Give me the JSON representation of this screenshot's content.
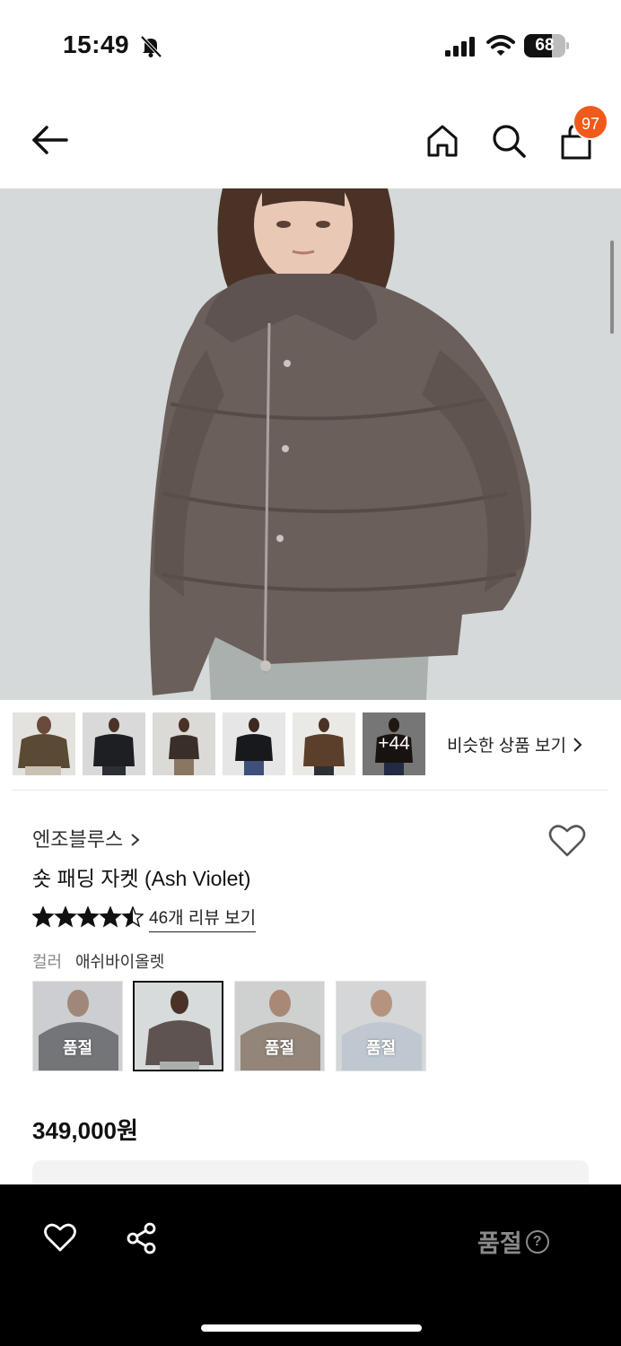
{
  "status": {
    "time": "15:49",
    "battery": "68",
    "battery_level": 0.68,
    "icons": [
      "bell-slash-icon",
      "signal-icon",
      "wifi-icon",
      "battery-icon"
    ]
  },
  "nav": {
    "icons": [
      "back-arrow-icon",
      "home-icon",
      "search-icon",
      "shopping-bag-icon"
    ],
    "cart_count": "97",
    "badge_color": "#f05a1a"
  },
  "gallery": {
    "thumbnails": [
      {
        "label": "thumbnail-1"
      },
      {
        "label": "thumbnail-2"
      },
      {
        "label": "thumbnail-3"
      },
      {
        "label": "thumbnail-4"
      },
      {
        "label": "thumbnail-5"
      },
      {
        "label": "thumbnail-6"
      }
    ],
    "more_count": "+44",
    "similar_link": "비슷한 상품 보기"
  },
  "product": {
    "brand": "엔조블루스",
    "name": "숏 패딩 자켓 (Ash Violet)",
    "rating": 4.5,
    "review_link": "46개 리뷰 보기",
    "color_label": "컬러",
    "color_value": "애쉬바이올렛",
    "swatches": [
      {
        "name": "charcoal",
        "status": "품절"
      },
      {
        "name": "ash-violet",
        "status": "",
        "selected": true
      },
      {
        "name": "brown",
        "status": "품절"
      },
      {
        "name": "light-blue",
        "status": "품절"
      }
    ],
    "price": "349,000원"
  },
  "bottom_bar": {
    "icons": [
      "heart-icon",
      "share-icon",
      "help-icon"
    ],
    "soldout_label": "품절",
    "help": "?"
  }
}
